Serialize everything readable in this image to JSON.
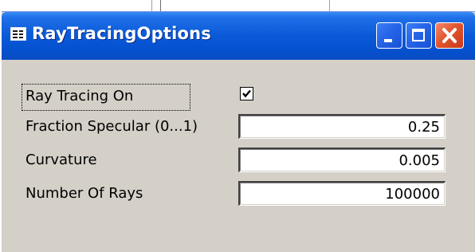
{
  "window": {
    "title": "RayTracingOptions",
    "icon": "form-icon",
    "controls": {
      "minimize_icon": "minimize-icon",
      "maximize_icon": "maximize-icon",
      "close_icon": "close-icon"
    }
  },
  "form": {
    "ray_tracing": {
      "label": "Ray Tracing On",
      "checked": true
    },
    "fraction_specular": {
      "label": "Fraction Specular (0...1)",
      "value": "0.25"
    },
    "curvature": {
      "label": "Curvature",
      "value": "0.005"
    },
    "number_of_rays": {
      "label": "Number Of Rays",
      "value": "100000"
    }
  },
  "colors": {
    "titlebar": "#0a5ad8",
    "close_button": "#e2552f",
    "dialog_face": "#d4d0c8"
  }
}
